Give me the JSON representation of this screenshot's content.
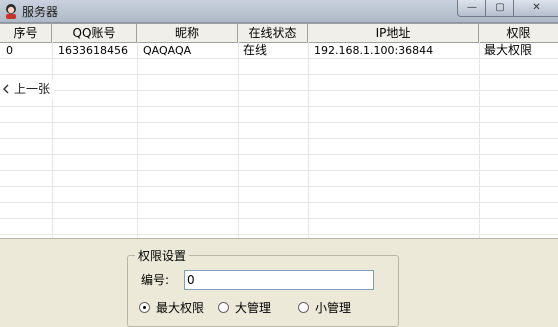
{
  "window": {
    "title": "服务器",
    "minimize_glyph": "—",
    "maximize_glyph": "▢",
    "close_glyph": "✕"
  },
  "table": {
    "columns": [
      "序号",
      "QQ账号",
      "昵称",
      "在线状态",
      "IP地址",
      "权限"
    ],
    "rows": [
      [
        "0",
        "1633618456",
        "QAQAQA",
        "在线",
        "192.168.1.100:36844",
        "最大权限"
      ]
    ]
  },
  "overlay": {
    "prev_label": "上一张"
  },
  "permissions": {
    "group_title": "权限设置",
    "id_label": "编号:",
    "id_value": "0",
    "options": [
      "最大权限",
      "大管理",
      "小管理"
    ],
    "selected": "最大权限"
  }
}
